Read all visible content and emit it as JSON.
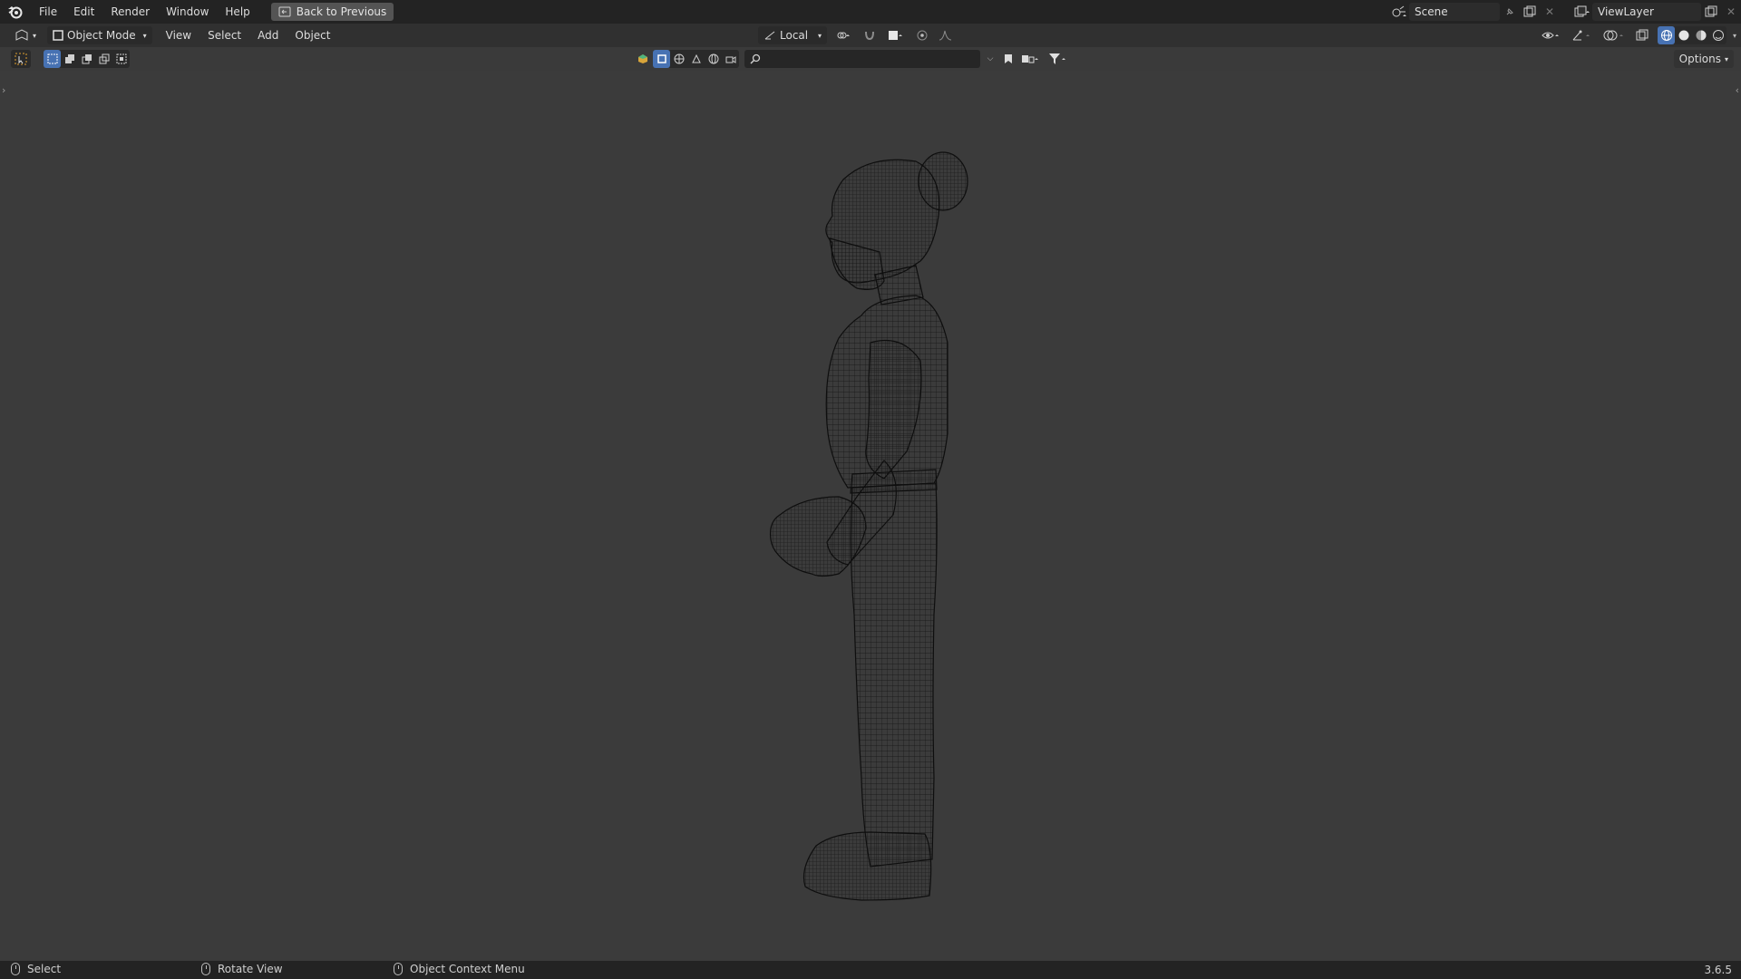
{
  "topbar": {
    "menus": [
      "File",
      "Edit",
      "Render",
      "Window",
      "Help"
    ],
    "back_button": "Back to Previous",
    "scene": "Scene",
    "view_layer": "ViewLayer"
  },
  "viewport_header": {
    "mode": "Object Mode",
    "menus": [
      "View",
      "Select",
      "Add",
      "Object"
    ],
    "transform_orientation": "Local"
  },
  "tool_row": {
    "search_placeholder": "",
    "options_label": "Options"
  },
  "statusbar": {
    "select": "Select",
    "rotate": "Rotate View",
    "context_menu": "Object Context Menu",
    "version": "3.6.5"
  },
  "icons": {
    "logo": "blender-logo-icon",
    "back": "back-to-previous-icon",
    "scene_type": "scene-icon",
    "view_layer_type": "view-layer-icon",
    "editor_type": "editor-type-icon",
    "pivot": "pivot-point-icon",
    "snap": "snap-icon",
    "proportional": "proportional-editing-icon",
    "search": "search-icon",
    "filter": "filter-icon",
    "shading_wireframe": "wireframe-shading-icon",
    "shading_solid": "solid-shading-icon",
    "shading_material": "material-shading-icon",
    "shading_rendered": "rendered-shading-icon"
  },
  "colors": {
    "accent": "#4772b3",
    "viewport_bg": "#3b3b3b",
    "wireframe": "#0f0f0f"
  }
}
